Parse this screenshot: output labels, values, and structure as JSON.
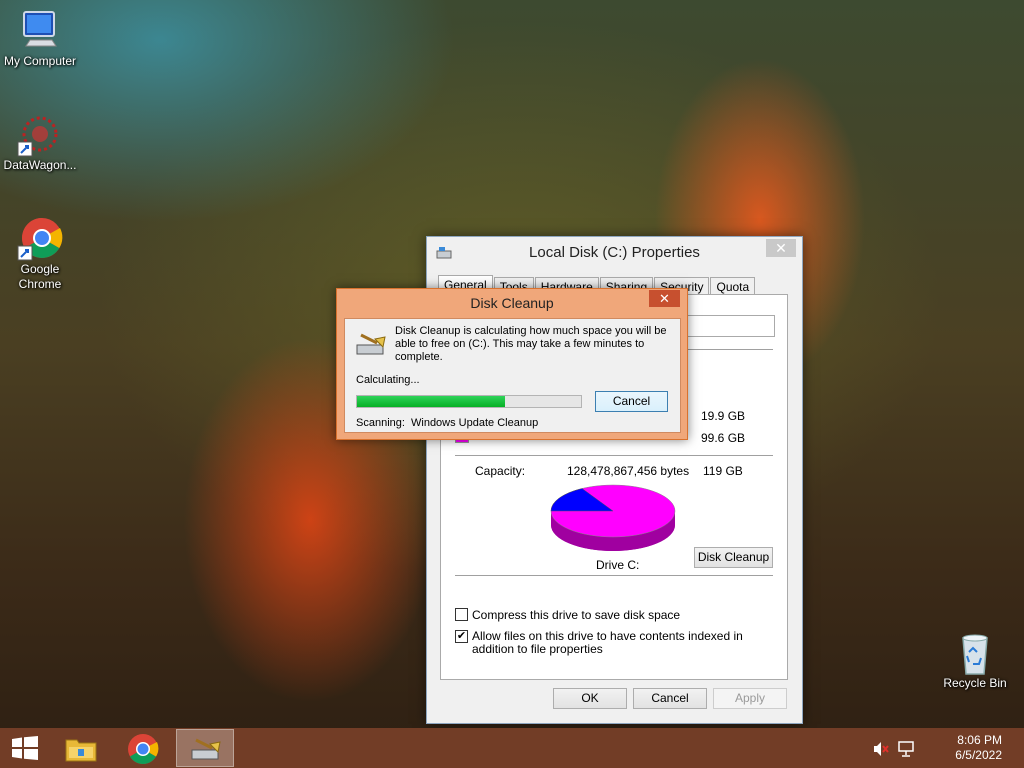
{
  "desktop": {
    "icons": [
      {
        "label": "My Computer",
        "icon": "computer-icon"
      },
      {
        "label": "DataWagon...",
        "icon": "datawagon-icon"
      },
      {
        "label": "Google Chrome",
        "icon": "chrome-icon"
      },
      {
        "label": "Recycle Bin",
        "icon": "recycle-bin-icon"
      }
    ]
  },
  "properties": {
    "title": "Local Disk (C:) Properties",
    "tabs": [
      "General",
      "Tools",
      "Hardware",
      "Sharing",
      "Security",
      "Quota"
    ],
    "active_tab": "General",
    "used_space_gb": "19.9 GB",
    "free_space_gb": "99.6 GB",
    "capacity_label": "Capacity:",
    "capacity_bytes": "128,478,867,456 bytes",
    "capacity_gb": "119 GB",
    "drive_label": "Drive C:",
    "disk_cleanup_button": "Disk Cleanup",
    "compress_label": "Compress this drive to save disk space",
    "compress_checked": false,
    "index_label": "Allow files on this drive to have contents indexed in addition to file properties",
    "index_checked": true,
    "ok_button": "OK",
    "cancel_button": "Cancel",
    "apply_button": "Apply",
    "colors": {
      "used": "#0000ff",
      "free": "#ff00ff"
    },
    "pie": {
      "used_fraction": 0.167,
      "free_fraction": 0.833
    }
  },
  "cleanup": {
    "title": "Disk Cleanup",
    "message": "Disk Cleanup is calculating how much space you will be able to free on  (C:). This may take a few minutes to complete.",
    "status": "Calculating...",
    "progress": 0.66,
    "cancel_button": "Cancel",
    "scanning_label": "Scanning:",
    "scanning_item": "Windows Update Cleanup"
  },
  "taskbar": {
    "start_icon": "windows-start-icon",
    "apps": [
      "file-explorer-icon",
      "chrome-icon",
      "disk-cleanup-icon"
    ],
    "time": "8:06 PM",
    "date": "6/5/2022",
    "tray": [
      "speaker-muted-icon",
      "network-icon"
    ]
  }
}
